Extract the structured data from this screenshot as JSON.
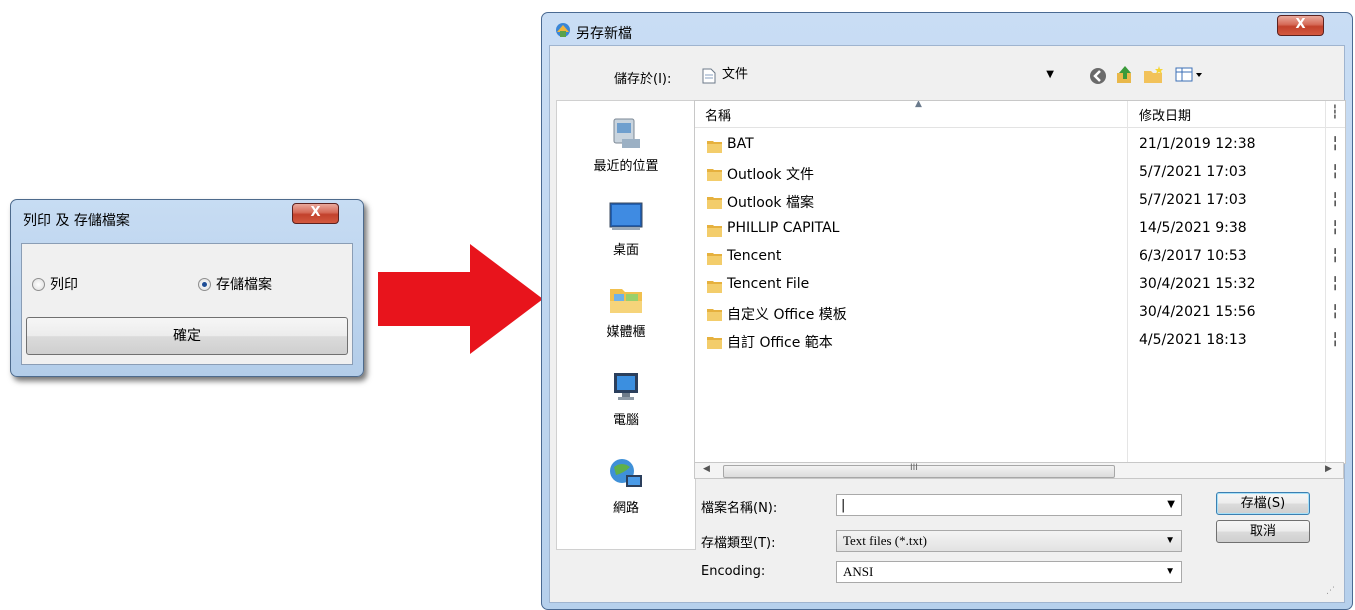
{
  "small_dialog": {
    "title": "列印 及 存儲檔案",
    "close_label": "X",
    "option_print": "列印",
    "option_save": "存儲檔案",
    "selected": "存儲檔案",
    "ok_label": "確定"
  },
  "save_dialog": {
    "title": "另存新檔",
    "close_label": "X",
    "save_in_label": "儲存於(I):",
    "save_in_value": "文件",
    "places": [
      {
        "label": "最近的位置",
        "icon": "recent-places-icon"
      },
      {
        "label": "桌面",
        "icon": "desktop-icon"
      },
      {
        "label": "媒體櫃",
        "icon": "libraries-icon"
      },
      {
        "label": "電腦",
        "icon": "computer-icon"
      },
      {
        "label": "網路",
        "icon": "network-icon"
      }
    ],
    "columns": {
      "name": "名稱",
      "date": "修改日期"
    },
    "files": [
      {
        "name": "BAT",
        "date": "21/1/2019 12:38"
      },
      {
        "name": "Outlook 文件",
        "date": "5/7/2021 17:03"
      },
      {
        "name": "Outlook 檔案",
        "date": "5/7/2021 17:03"
      },
      {
        "name": "PHILLIP CAPITAL",
        "date": "14/5/2021 9:38"
      },
      {
        "name": "Tencent",
        "date": "6/3/2017 10:53"
      },
      {
        "name": "Tencent File",
        "date": "30/4/2021 15:32"
      },
      {
        "name": "自定义 Office 模板",
        "date": "30/4/2021 15:56"
      },
      {
        "name": "自訂 Office 範本",
        "date": "4/5/2021 18:13"
      }
    ],
    "scroll_grip": "III",
    "filename_label": "檔案名稱(N):",
    "filename_value": "",
    "filetype_label": "存檔類型(T):",
    "filetype_value": "Text files (*.txt)",
    "encoding_label": "Encoding:",
    "encoding_value": "ANSI",
    "save_button": "存檔(S)",
    "cancel_button": "取消"
  },
  "colors": {
    "arrow": "#e8141c",
    "titlebar": "#c2d8f2",
    "close": "#c7452f"
  }
}
